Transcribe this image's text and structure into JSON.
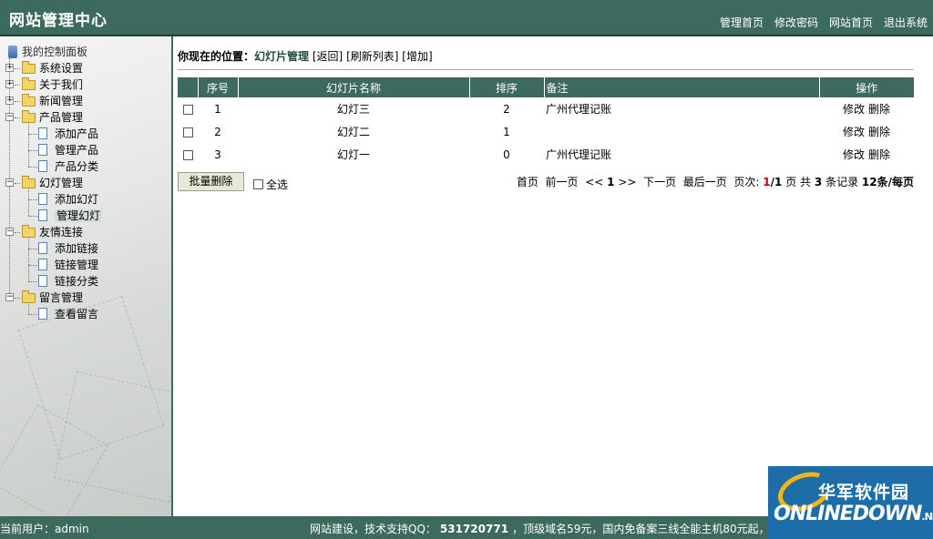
{
  "header": {
    "title": "网站管理中心",
    "nav": [
      "管理首页",
      "修改密码",
      "网站首页",
      "退出系统"
    ]
  },
  "sidebar": {
    "root": "我的控制面板",
    "groups": [
      {
        "label": "系统设置",
        "expanded": false,
        "children": []
      },
      {
        "label": "关于我们",
        "expanded": false,
        "children": []
      },
      {
        "label": "新闻管理",
        "expanded": false,
        "children": []
      },
      {
        "label": "产品管理",
        "expanded": true,
        "children": [
          "添加产品",
          "管理产品",
          "产品分类"
        ]
      },
      {
        "label": "幻灯管理",
        "expanded": true,
        "children": [
          "添加幻灯",
          "管理幻灯"
        ]
      },
      {
        "label": "友情连接",
        "expanded": true,
        "children": [
          "添加链接",
          "链接管理",
          "链接分类"
        ]
      },
      {
        "label": "留言管理",
        "expanded": true,
        "children": [
          "查看留言"
        ]
      }
    ],
    "active": "管理幻灯"
  },
  "breadcrumb": {
    "prefix": "你现在的位置：",
    "current": "幻灯片管理",
    "links": [
      "[返回]",
      "[刷新列表]",
      "[增加]"
    ]
  },
  "table": {
    "headers": [
      "",
      "序号",
      "幻灯片名称",
      "排序",
      "备注",
      "操作"
    ],
    "rows": [
      {
        "id": "1",
        "name": "幻灯三",
        "order": "2",
        "note": "广州代理记账"
      },
      {
        "id": "2",
        "name": "幻灯二",
        "order": "1",
        "note": ""
      },
      {
        "id": "3",
        "name": "幻灯一",
        "order": "0",
        "note": "广州代理记账"
      }
    ],
    "edit_label": "修改",
    "delete_label": "删除"
  },
  "actions": {
    "bulk_delete": "批量删除",
    "select_all": "全选"
  },
  "pager": {
    "first": "首页",
    "prev": "前一页",
    "prev_arrow": "<<",
    "page_num": "1",
    "next_arrow": ">>",
    "next": "下一页",
    "last": "最后一页",
    "page_label": "页次:",
    "current_page": "1",
    "total_pages": "/1",
    "page_unit": "页",
    "total_prefix": "共",
    "total_records": "3",
    "records_unit": "条记录",
    "per_page": "12条/每页"
  },
  "footer": {
    "user": "当前用户：admin",
    "support_prefix": "网站建设，技术支持QQ：",
    "qq": "531720771",
    "support_suffix": "，顶级域名59元，国内免备案三线全能主机80元起，更多"
  },
  "watermark": {
    "cn": "华军软件园",
    "en": "ONLINEDOWN",
    "en_suffix": ".NET"
  },
  "colors": {
    "primary": "#3d6a5e",
    "active_bg": "#d3dcd8",
    "page_current": "#c00000"
  }
}
